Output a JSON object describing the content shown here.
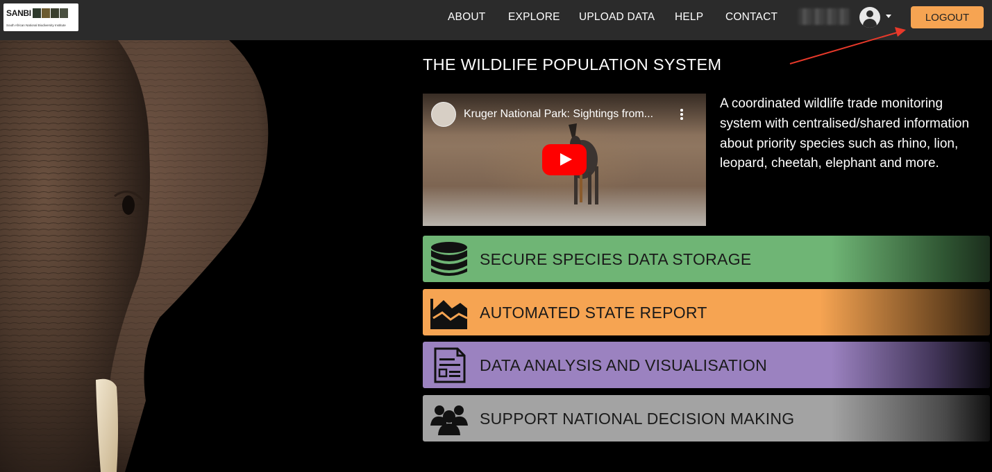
{
  "navbar": {
    "logo": {
      "text": "SANBI",
      "subtitle": "South African National Biodiversity Institute"
    },
    "links": [
      {
        "label": "ABOUT"
      },
      {
        "label": "EXPLORE"
      },
      {
        "label": "UPLOAD DATA"
      },
      {
        "label": "HELP"
      },
      {
        "label": "CONTACT"
      }
    ],
    "logout_label": "LOGOUT",
    "user_icon": "user-avatar-icon"
  },
  "main": {
    "title": "THE WILDLIFE POPULATION SYSTEM",
    "video": {
      "title": "Kruger National Park: Sightings from..."
    },
    "description": "A coordinated wildlife trade monitoring system with centralised/shared information about priority species such as rhino, lion, leopard, cheetah, elephant and more.",
    "features": [
      {
        "label": "SECURE SPECIES DATA STORAGE",
        "icon": "database-icon",
        "color": "#6fb575"
      },
      {
        "label": "AUTOMATED STATE REPORT",
        "icon": "area-chart-icon",
        "color": "#f6a452"
      },
      {
        "label": "DATA ANALYSIS AND VISUALISATION",
        "icon": "report-document-icon",
        "color": "#9b82c0"
      },
      {
        "label": "SUPPORT NATIONAL DECISION MAKING",
        "icon": "users-group-icon",
        "color": "#a3a3a3"
      }
    ]
  },
  "colors": {
    "navbar_bg": "#2b2b2b",
    "accent": "#f6a452",
    "annotation": "#e8392a"
  }
}
